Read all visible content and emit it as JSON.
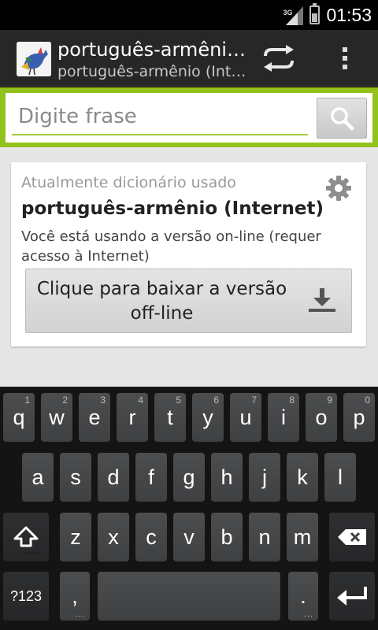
{
  "status_bar": {
    "network": "3G",
    "time": "01:53"
  },
  "action_bar": {
    "title": "português-armênio (Internet)",
    "subtitle": "português-armênio (Internet)"
  },
  "search": {
    "placeholder": "Digite frase"
  },
  "card": {
    "caption": "Atualmente dicionário usado",
    "dictionary": "português-armênio (Internet)",
    "description": "Você está usando a versão on-line (requer acesso à Internet)",
    "download_label": "Clique para baixar a versão off-line"
  },
  "keyboard": {
    "row1": [
      {
        "k": "q",
        "h": "1"
      },
      {
        "k": "w",
        "h": "2"
      },
      {
        "k": "e",
        "h": "3"
      },
      {
        "k": "r",
        "h": "4"
      },
      {
        "k": "t",
        "h": "5"
      },
      {
        "k": "y",
        "h": "6"
      },
      {
        "k": "u",
        "h": "7"
      },
      {
        "k": "i",
        "h": "8"
      },
      {
        "k": "o",
        "h": "9"
      },
      {
        "k": "p",
        "h": "0"
      }
    ],
    "row2": [
      "a",
      "s",
      "d",
      "f",
      "g",
      "h",
      "j",
      "k",
      "l"
    ],
    "row3": [
      "z",
      "x",
      "c",
      "v",
      "b",
      "n",
      "m"
    ],
    "symbols_key": "?123",
    "comma_key": ",",
    "period_key": ".",
    "dots": "..."
  },
  "colors": {
    "accent": "#94c21c",
    "action_bar": "#272727",
    "background": "#e6e6e6"
  },
  "icons": [
    "signal-icon",
    "battery-icon",
    "app-icon",
    "swap-icon",
    "overflow-icon",
    "search-icon",
    "gear-icon",
    "download-icon",
    "shift-icon",
    "backspace-icon",
    "enter-icon"
  ]
}
